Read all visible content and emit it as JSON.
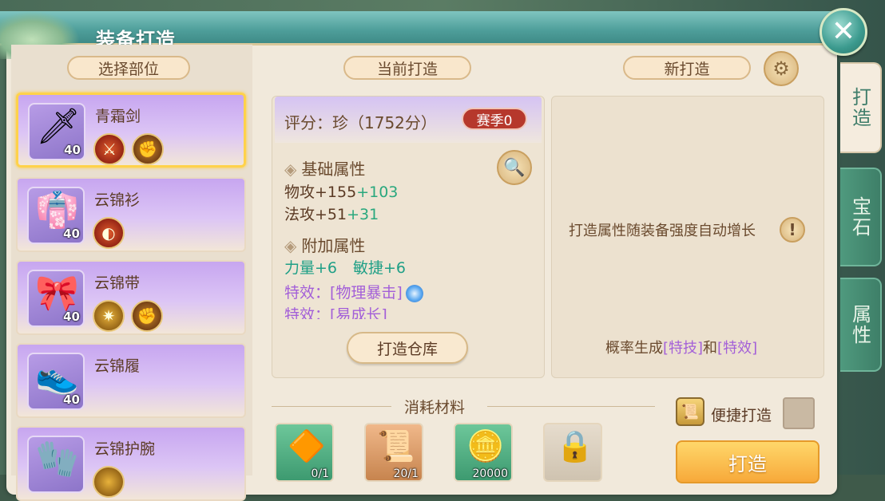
{
  "window": {
    "title": "装备打造"
  },
  "left": {
    "header": "选择部位",
    "items": [
      {
        "name": "青霜剑",
        "level": "40",
        "icon": "sword-icon",
        "selected": true
      },
      {
        "name": "云锦衫",
        "level": "40",
        "icon": "robe-icon",
        "selected": false
      },
      {
        "name": "云锦带",
        "level": "40",
        "icon": "belt-icon",
        "selected": false
      },
      {
        "name": "云锦履",
        "level": "40",
        "icon": "shoes-icon",
        "selected": false
      },
      {
        "name": "云锦护腕",
        "level": "",
        "icon": "bracer-icon",
        "selected": false
      }
    ]
  },
  "middle": {
    "header": "当前打造",
    "score": "评分：珍（1752分）",
    "season_badge": "赛季0",
    "base_title": "基础属性",
    "base_stats": [
      {
        "label": "物攻+155",
        "bonus": "+103"
      },
      {
        "label": "法攻+51",
        "bonus": "+31"
      }
    ],
    "extra_title": "附加属性",
    "extra_stats": {
      "a": "力量+6",
      "b": "敏捷+6"
    },
    "effect_1": "特效：[物理暴击]",
    "effect_2": "特效：[易成长]",
    "warehouse_btn": "打造仓库"
  },
  "right": {
    "header": "新打造",
    "hint": "打造属性随装备强度自动增长",
    "prob_prefix": "概率生成",
    "prob_skill": "[特技]",
    "prob_and": "和",
    "prob_effect": "[特效]"
  },
  "materials": {
    "title": "消耗材料",
    "items": [
      {
        "icon": "forge-stone-icon",
        "count": "0/1"
      },
      {
        "icon": "scroll-icon",
        "count": "20/1"
      },
      {
        "icon": "coin-icon",
        "count": "20000"
      },
      {
        "icon": "lock-icon",
        "count": ""
      }
    ]
  },
  "actions": {
    "quick_label": "便捷打造",
    "forge_btn": "打造"
  },
  "tabs": [
    "打造",
    "宝石",
    "属性"
  ]
}
